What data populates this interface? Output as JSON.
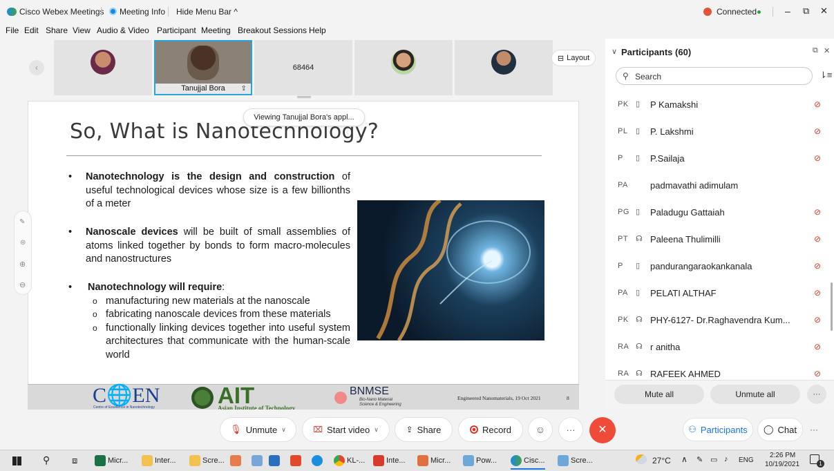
{
  "titlebar": {
    "app_name": "Cisco Webex Meetings",
    "meeting_info": "Meeting Info",
    "hide_menu": "Hide Menu Bar ^",
    "connected": "Connected",
    "minimize": "–",
    "restore": "⧉",
    "close": "✕"
  },
  "menu": [
    "File",
    "Edit",
    "Share",
    "View",
    "Audio & Video",
    "Participant",
    "Meeting",
    "Breakout Sessions",
    "Help"
  ],
  "strip": {
    "active_speaker": "Tanujjal Bora",
    "number_tile": "68464",
    "layout_label": "Layout",
    "viewing_tooltip": "Viewing Tanujjal Bora's appl..."
  },
  "slide": {
    "title": "So, What is Nanotechnology?",
    "b1_bold": "Nanotechnology is the design and construction",
    "b1_rest": " of useful  technological devices whose size is a few billionths of a meter",
    "b2_bold": "Nanoscale devices",
    "b2_rest": " will be built of small assemblies of atoms linked together by bonds to form macro-molecules and nanostructures",
    "b3_bold": "Nanotechnology will require",
    "b3_colon": ":",
    "sub": [
      "manufacturing new materials at the nanoscale",
      "fabricating nanoscale devices from these materials",
      "functionally linking devices together into useful system architectures that communicate with the human-scale world"
    ],
    "logo_coen": "C🌐EN",
    "logo_coen_sub": "Centre of Excellence in Nanotechnology",
    "logo_ait": "AIT",
    "logo_ait_sub": "Asian Institute of Technology",
    "logo_bnmse": "BNMSE",
    "logo_bnmse_sub1": "Bio-Nano Material",
    "logo_bnmse_sub2": "Science & Engineering",
    "footer_text": "Engineered Nanomaterials, 19 Oct 2021",
    "page_number": "8"
  },
  "panel": {
    "title": "Participants (60)",
    "search_placeholder": "Search",
    "participants": [
      {
        "ini": "PK",
        "dev": "▯",
        "name": "P Kamakshi",
        "muted": true
      },
      {
        "ini": "PL",
        "dev": "▯",
        "name": "P. Lakshmi",
        "muted": true
      },
      {
        "ini": "P",
        "dev": "▯",
        "name": "P.Sailaja",
        "muted": true
      },
      {
        "ini": "PA",
        "dev": "",
        "name": "padmavathi adimulam",
        "muted": false
      },
      {
        "ini": "PG",
        "dev": "▯",
        "name": "Paladugu Gattaiah",
        "muted": true
      },
      {
        "ini": "PT",
        "dev": "☊",
        "name": "Paleena Thulimilli",
        "muted": true
      },
      {
        "ini": "P",
        "dev": "▯",
        "name": "pandurangaraokankanala",
        "muted": true
      },
      {
        "ini": "PA",
        "dev": "▯",
        "name": "PELATI ALTHAF",
        "muted": true
      },
      {
        "ini": "PK",
        "dev": "☊",
        "name": "PHY-6127- Dr.Raghavendra Kum...",
        "muted": true
      },
      {
        "ini": "RA",
        "dev": "☊",
        "name": "r anitha",
        "muted": true
      },
      {
        "ini": "RA",
        "dev": "☊",
        "name": "RAFEEK AHMED",
        "muted": true
      }
    ],
    "mute_all": "Mute all",
    "unmute_all": "Unmute all",
    "more": "···"
  },
  "controls": {
    "unmute": "Unmute",
    "start_video": "Start video",
    "share": "Share",
    "record": "Record",
    "more": "···",
    "participants": "Participants",
    "chat": "Chat"
  },
  "taskbar": {
    "apps": [
      "Micr...",
      "Inter...",
      "Scre...",
      "KL-...",
      "Inte...",
      "Micr...",
      "Pow...",
      "Cisc...",
      "Scre..."
    ],
    "weather": "27°C",
    "lang": "ENG",
    "time": "2:26 PM",
    "date": "10/19/2021",
    "notif": "1"
  },
  "colors": {
    "accent_blue": "#1a73e8",
    "end_red": "#f04a3a",
    "connected_green": "#2ea043",
    "record_red": "#d9342b",
    "highlight_border": "#27a5e0"
  }
}
